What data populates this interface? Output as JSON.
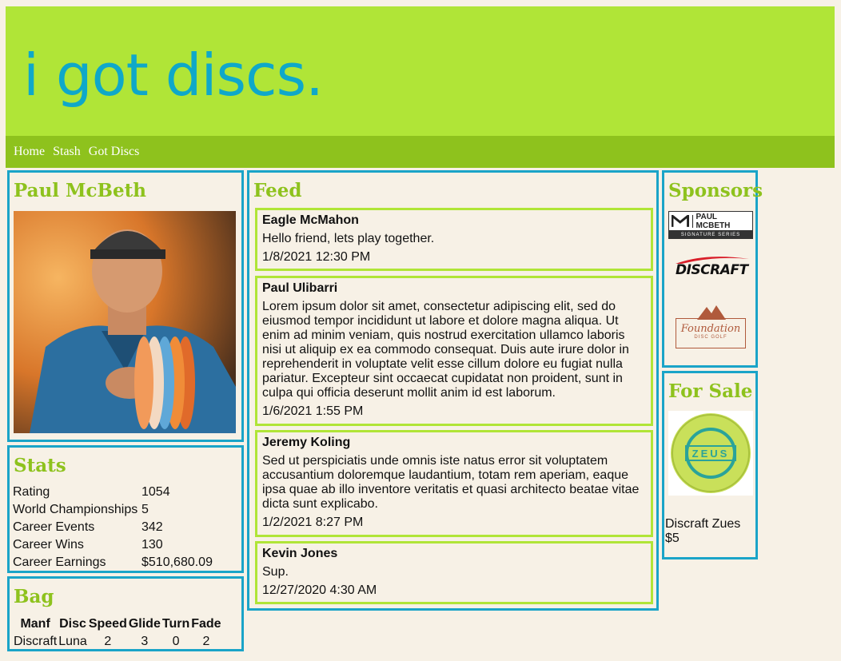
{
  "logo": "i got discs.",
  "nav": [
    "Home",
    "Stash",
    "Got Discs"
  ],
  "profile": {
    "name": "Paul McBeth"
  },
  "stats": {
    "title": "Stats",
    "rows": [
      {
        "label": "Rating",
        "value": "1054"
      },
      {
        "label": "World Championships",
        "value": "5"
      },
      {
        "label": "Career Events",
        "value": "342"
      },
      {
        "label": "Career Wins",
        "value": "130"
      },
      {
        "label": "Career Earnings",
        "value": "$510,680.09"
      }
    ]
  },
  "bag": {
    "title": "Bag",
    "headers": [
      "Manf",
      "Disc",
      "Speed",
      "Glide",
      "Turn",
      "Fade"
    ],
    "rows": [
      [
        "Discraft",
        "Luna",
        "2",
        "3",
        "0",
        "2"
      ]
    ]
  },
  "feed": {
    "title": "Feed",
    "posts": [
      {
        "author": "Eagle McMahon",
        "body": "Hello friend, lets play together.",
        "time": "1/8/2021 12:30 PM"
      },
      {
        "author": "Paul Ulibarri",
        "body": "Lorem ipsum dolor sit amet, consectetur adipiscing elit, sed do eiusmod tempor incididunt ut labore et dolore magna aliqua. Ut enim ad minim veniam, quis nostrud exercitation ullamco laboris nisi ut aliquip ex ea commodo consequat. Duis aute irure dolor in reprehenderit in voluptate velit esse cillum dolore eu fugiat nulla pariatur. Excepteur sint occaecat cupidatat non proident, sunt in culpa qui officia deserunt mollit anim id est laborum.",
        "time": "1/6/2021 1:55 PM"
      },
      {
        "author": "Jeremy Koling",
        "body": "Sed ut perspiciatis unde omnis iste natus error sit voluptatem accusantium doloremque laudantium, totam rem aperiam, eaque ipsa quae ab illo inventore veritatis et quasi architecto beatae vitae dicta sunt explicabo.",
        "time": "1/2/2021 8:27 PM"
      },
      {
        "author": "Kevin Jones",
        "body": "Sup.",
        "time": "12/27/2020 4:30 AM"
      }
    ]
  },
  "sponsors": {
    "title": "Sponsors",
    "logos": [
      {
        "text": "PAUL MCBETH",
        "subtext": "SIGNATURE SERIES"
      },
      {
        "text": "DISCRAFT"
      },
      {
        "text": "Foundation",
        "subtext": "DISC GOLF"
      }
    ]
  },
  "for_sale": {
    "title": "For Sale",
    "disc_stamp": "ZEUS",
    "item": "Discraft Zues",
    "price": "$5"
  },
  "colors": {
    "header": "#b0e537",
    "nav": "#8ec21d",
    "accent": "#1aa4c8",
    "logo": "#0fa8c9",
    "background": "#f7f1e6"
  }
}
